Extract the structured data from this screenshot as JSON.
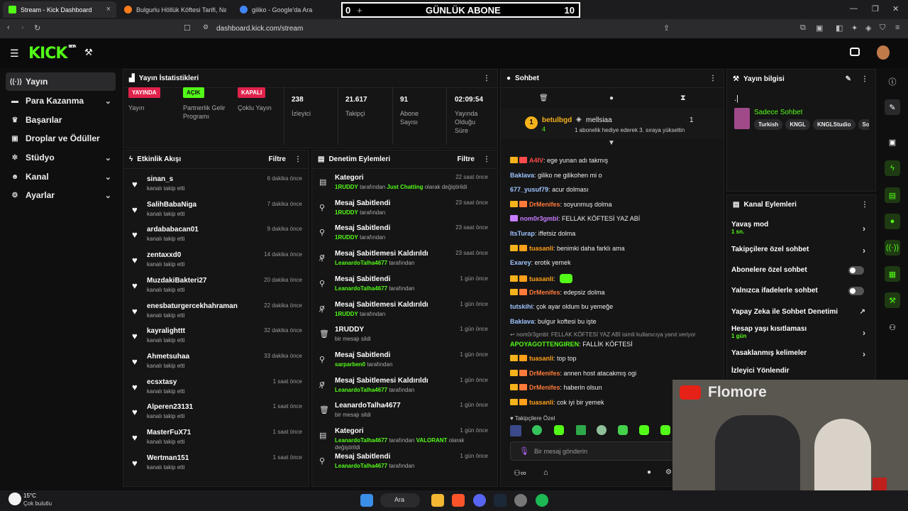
{
  "browser": {
    "tabs": [
      {
        "label": "Stream - Kick Dashboard",
        "color": "#53fc18"
      },
      {
        "label": "Bulgurlu Höllük Köftesi Tarifi, Nasıl Ya",
        "color": "#ff7a1a"
      },
      {
        "label": "giliko - Google'da Ara",
        "color": "#4285f4"
      }
    ],
    "url": "dashboard.kick.com/stream"
  },
  "overlay": {
    "left_count": "0",
    "plus": "+",
    "title": "GÜNLÜK ABONE",
    "right_count": "10"
  },
  "logo": "KICK",
  "logo_tag": "BETA",
  "sidebar": {
    "items": [
      {
        "label": "Yayın",
        "icon": "antenna-icon",
        "chevron": false
      },
      {
        "label": "Para Kazanma",
        "icon": "money-icon",
        "chevron": true
      },
      {
        "label": "Başarılar",
        "icon": "trophy-icon",
        "chevron": false
      },
      {
        "label": "Droplar ve Ödüller",
        "icon": "gift-icon",
        "chevron": false
      },
      {
        "label": "Stüdyo",
        "icon": "studio-icon",
        "chevron": true
      },
      {
        "label": "Kanal",
        "icon": "user-icon",
        "chevron": true
      },
      {
        "label": "Ayarlar",
        "icon": "gear-icon",
        "chevron": true
      }
    ]
  },
  "stats": {
    "title": "Yayın İstatistikleri",
    "items": [
      {
        "badge": "YAYINDA",
        "label": "Yayın",
        "badge_color": "#e0224b"
      },
      {
        "badge": "AÇIK",
        "label": "Partnerlik Gelir Programı",
        "badge_color": "#53fc18"
      },
      {
        "badge": "KAPALI",
        "label": "Çoklu Yayın",
        "badge_color": "#e0224b"
      },
      {
        "value": "238",
        "label": "İzleyici"
      },
      {
        "value": "21.617",
        "label": "Takipçi"
      },
      {
        "value": "91",
        "label": "Abone Sayısı"
      },
      {
        "value": "02:09:54",
        "label": "Yayında Olduğu Süre"
      }
    ]
  },
  "activity": {
    "title": "Etkinlik Akışı",
    "filter": "Filtre",
    "rows": [
      {
        "name": "sinan_s",
        "sub": "kanalı takip etti",
        "time": "6 dakika önce"
      },
      {
        "name": "SalihBabaNiga",
        "sub": "kanalı takip etti",
        "time": "7 dakika önce"
      },
      {
        "name": "ardababacan01",
        "sub": "kanalı takip etti",
        "time": "9 dakika önce"
      },
      {
        "name": "zentaxxd0",
        "sub": "kanalı takip etti",
        "time": "14 dakika önce"
      },
      {
        "name": "MuzdakiBakteri27",
        "sub": "kanalı takip etti",
        "time": "20 dakika önce"
      },
      {
        "name": "enesbaturgercekhahraman",
        "sub": "kanalı takip etti",
        "time": "22 dakika önce"
      },
      {
        "name": "kayralighttt",
        "sub": "kanalı takip etti",
        "time": "32 dakika önce"
      },
      {
        "name": "Ahmetsuhaa",
        "sub": "kanalı takip etti",
        "time": "33 dakika önce"
      },
      {
        "name": "ecsxtasy",
        "sub": "kanalı takip etti",
        "time": "1 saat önce"
      },
      {
        "name": "Alperen23131",
        "sub": "kanalı takip etti",
        "time": "1 saat önce"
      },
      {
        "name": "MasterFuX71",
        "sub": "kanalı takip etti",
        "time": "1 saat önce"
      },
      {
        "name": "Wertman151",
        "sub": "kanalı takip etti",
        "time": "1 saat önce"
      }
    ]
  },
  "moderation": {
    "title": "Denetim Eylemleri",
    "filter": "Filtre",
    "rows": [
      {
        "icon": "category-icon",
        "name": "Kategori",
        "user": "1RUDDY",
        "mid": " tarafından ",
        "extra": "Just Chatting",
        "end": " olarak değiştirildi",
        "time": "22 saat önce"
      },
      {
        "icon": "pin-icon",
        "name": "Mesaj Sabitlendi",
        "user": "1RUDDY",
        "mid": " tarafından",
        "extra": "",
        "end": "",
        "time": "23 saat önce"
      },
      {
        "icon": "pin-icon",
        "name": "Mesaj Sabitlendi",
        "user": "1RUDDY",
        "mid": " tarafından",
        "extra": "",
        "end": "",
        "time": "23 saat önce"
      },
      {
        "icon": "unpin-icon",
        "name": "Mesaj Sabitlemesi Kaldırıldı",
        "user": "LeanardoTalha4677",
        "mid": " tarafından",
        "extra": "",
        "end": "",
        "time": "23 saat önce"
      },
      {
        "icon": "pin-icon",
        "name": "Mesaj Sabitlendi",
        "user": "LeanardoTalha4677",
        "mid": " tarafından",
        "extra": "",
        "end": "",
        "time": "1 gün önce"
      },
      {
        "icon": "unpin-icon",
        "name": "Mesaj Sabitlemesi Kaldırıldı",
        "user": "1RUDDY",
        "mid": " tarafından",
        "extra": "",
        "end": "",
        "time": "1 gün önce"
      },
      {
        "icon": "trash-icon",
        "name": "1RUDDY",
        "user": "",
        "mid": "bir mesajı sildi",
        "extra": "",
        "end": "",
        "time": "1 gün önce"
      },
      {
        "icon": "pin-icon",
        "name": "Mesaj Sabitlendi",
        "user": "sarparben0",
        "mid": " tarafından",
        "extra": "",
        "end": "",
        "time": "1 gün önce"
      },
      {
        "icon": "unpin-icon",
        "name": "Mesaj Sabitlemesi Kaldırıldı",
        "user": "LeanardoTalha4677",
        "mid": " tarafından",
        "extra": "",
        "end": "",
        "time": "1 gün önce"
      },
      {
        "icon": "trash-icon",
        "name": "LeanardoTalha4677",
        "user": "",
        "mid": "bir mesajı sildi",
        "extra": "",
        "end": "",
        "time": "1 gün önce"
      },
      {
        "icon": "category-icon",
        "name": "Kategori",
        "user": "LeanardoTalha4677",
        "mid": " tarafından ",
        "extra": "VALORANT",
        "end": " olarak değiştirildi",
        "time": "1 gün önce"
      },
      {
        "icon": "pin-icon",
        "name": "Mesaj Sabitlendi",
        "user": "LeanardoTalha4677",
        "mid": " tarafından",
        "extra": "",
        "end": "",
        "time": "1 gün önce"
      }
    ]
  },
  "chat": {
    "title": "Sohbet",
    "gift": {
      "user": "betulbgd",
      "level": "4",
      "target": "mellsiaa",
      "count": "1",
      "message": "1 abonelik hediye ederek 3. sıraya yükseltin"
    },
    "messages": [
      {
        "user": "A4IV",
        "color": "#ff4b4b",
        "text": "ege yunan adı takmış",
        "badges": "cs"
      },
      {
        "user": "Baklava",
        "color": "#9fc3ff",
        "text": "giliko ne gilikohen mi o",
        "badges": ""
      },
      {
        "user": "677_yusuf79",
        "color": "#9fc3ff",
        "text": "acur dolması",
        "badges": ""
      },
      {
        "user": "DrMenifes",
        "color": "#ff7a3a",
        "text": "soyunmuş dolma",
        "badges": "cs"
      },
      {
        "user": "nom0r3gmbl",
        "color": "#c77dff",
        "text": "FELLAK KÖFTESİ YAZ ABİ",
        "badges": "s"
      },
      {
        "user": "ItsTurap",
        "color": "#9fc3ff",
        "text": "iffetsiz dolma",
        "badges": ""
      },
      {
        "user": "tuasanli",
        "color": "#ff9f1a",
        "text": "benimki daha farklı ama",
        "badges": "cs"
      },
      {
        "user": "Exarey",
        "color": "#9fc3ff",
        "text": "erotik yemek",
        "badges": ""
      },
      {
        "user": "tuasanli",
        "color": "#ff9f1a",
        "text": "",
        "badges": "cs"
      },
      {
        "user": "DrMenifes",
        "color": "#ff7a3a",
        "text": "edepsiz dolma",
        "badges": "cs"
      },
      {
        "user": "tutskihi",
        "color": "#9fc3ff",
        "text": "çok ayar oldum bu yemeğe",
        "badges": ""
      },
      {
        "user": "Baklava",
        "color": "#9fc3ff",
        "text": "bulgur koftesi bu işte",
        "badges": ""
      },
      {
        "user": "APOYAGOTTENGIREN",
        "color": "#53fc18",
        "text": "FALLİK KÖFTESİ",
        "badges": "",
        "reply": "nom0r3gmbl: FELLAK KÖFTESİ YAZ ABİ isimli kullanıcıya yanıt veriyor"
      },
      {
        "user": "tuasanli",
        "color": "#ff9f1a",
        "text": "top top",
        "badges": "cs"
      },
      {
        "user": "DrMenifes",
        "color": "#ff7a3a",
        "text": "annen host atacakmış ogi",
        "badges": "cs"
      },
      {
        "user": "DrMenifes",
        "color": "#ff7a3a",
        "text": "haberin olsun",
        "badges": "cs"
      },
      {
        "user": "tuasanli",
        "color": "#ff9f1a",
        "text": "cok iyi bir yemek",
        "badges": "cs"
      }
    ],
    "followers_only": "Takipçilere Özel",
    "placeholder": "Bir mesaj gönderin"
  },
  "stream_info": {
    "title": "Yayın bilgisi",
    "caret": ".",
    "chat_label": "Sadece Sohbet",
    "tags": [
      "Turkish",
      "KNGL",
      "KNGLStudio",
      "So"
    ]
  },
  "channel_actions": {
    "title": "Kanal Eylemleri",
    "rows": [
      {
        "label": "Yavaş mod",
        "sub": "1 sn.",
        "control": "arrow"
      },
      {
        "label": "Takipçilere özel sohbet",
        "sub": "",
        "control": "arrow"
      },
      {
        "label": "Abonelere özel sohbet",
        "sub": "",
        "control": "toggle"
      },
      {
        "label": "Yalnızca ifadelerle sohbet",
        "sub": "",
        "control": "toggle"
      },
      {
        "label": "Yapay Zeka ile Sohbet Denetimi",
        "sub": "",
        "control": "external"
      },
      {
        "label": "Hesap yaşı kısıtlaması",
        "sub": "1 gün",
        "control": "arrow"
      },
      {
        "label": "Yasaklanmış kelimeler",
        "sub": "",
        "control": "arrow"
      },
      {
        "label": "İzleyici Yönlendir",
        "sub": "",
        "control": "none"
      }
    ]
  },
  "webcam": {
    "brand": "Flomore"
  },
  "taskbar": {
    "weather_temp": "15°C",
    "weather_desc": "Çok bulutlu",
    "search": "Ara"
  }
}
